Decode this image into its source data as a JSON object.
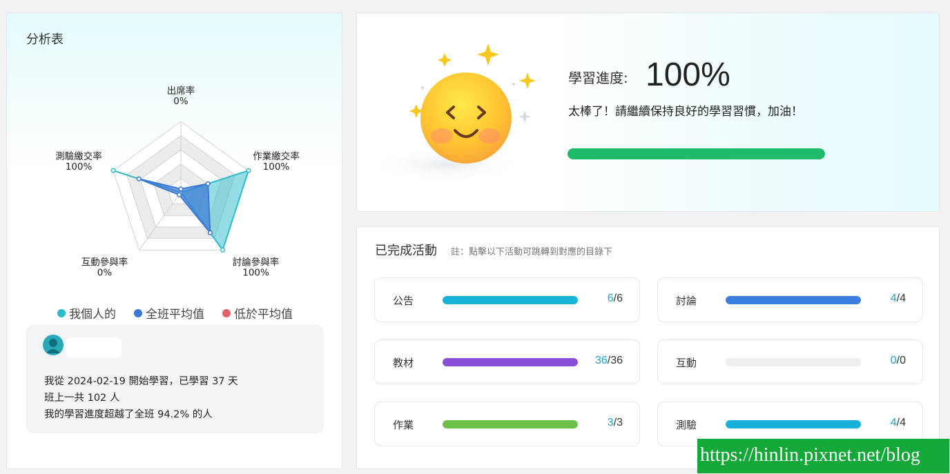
{
  "analysis": {
    "title": "分析表",
    "radar": {
      "axes": [
        {
          "label": "出席率",
          "value_label": "0%"
        },
        {
          "label": "作業繳交率",
          "value_label": "100%"
        },
        {
          "label": "討論參與率",
          "value_label": "100%"
        },
        {
          "label": "互動參與率",
          "value_label": "0%"
        },
        {
          "label": "測驗繳交率",
          "value_label": "100%"
        }
      ],
      "personal": [
        0,
        100,
        100,
        0,
        100
      ],
      "class_avg": [
        5,
        40,
        70,
        4,
        62
      ],
      "colors": {
        "personal": "#2bbcca",
        "class_avg": "#3a78d6",
        "below_avg": "#e06464"
      }
    },
    "legend": [
      {
        "label": "我個人的",
        "color": "#2bbcca"
      },
      {
        "label": "全班平均值",
        "color": "#3a78d6"
      },
      {
        "label": "低於平均值",
        "color": "#e06464"
      }
    ],
    "user": {
      "line1": "我從 2024-02-19 開始學習，已學習 37 天",
      "line2": "班上一共 102 人",
      "line3": "我的學習進度超越了全班 94.2% 的人"
    }
  },
  "progress": {
    "label": "學習進度:",
    "value": "100%",
    "fraction": 1.0,
    "message": "太棒了！請繼續保持良好的學習習慣，加油！",
    "color": "#1fba6a"
  },
  "activities": {
    "title": "已完成活動",
    "note": "註：點擊以下活動可跳轉到對應的目錄下",
    "items": [
      {
        "label": "公告",
        "done": "6",
        "total": "/6",
        "fraction": 1.0,
        "color": "#17b1d9"
      },
      {
        "label": "討論",
        "done": "4",
        "total": "/4",
        "fraction": 1.0,
        "color": "#3a7fe0"
      },
      {
        "label": "教材",
        "done": "36",
        "total": "/36",
        "fraction": 1.0,
        "color": "#8a4fd9"
      },
      {
        "label": "互動",
        "done": "0",
        "total": "/0",
        "fraction": 0.0,
        "color": "#cccccc"
      },
      {
        "label": "作業",
        "done": "3",
        "total": "/3",
        "fraction": 1.0,
        "color": "#6cc04a"
      },
      {
        "label": "測驗",
        "done": "4",
        "total": "/4",
        "fraction": 1.0,
        "color": "#17b1d9"
      }
    ]
  },
  "watermark": "https://hinlin.pixnet.net/blog"
}
